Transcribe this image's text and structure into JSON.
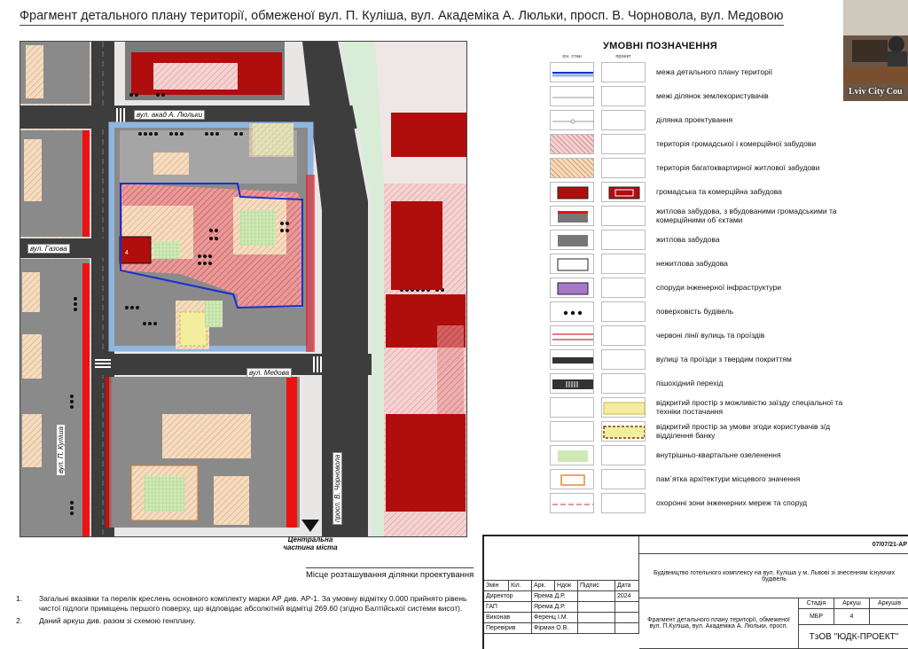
{
  "title": "Фрагмент детального плану території, обмеженої вул. П. Куліша, вул. Академіка А. Люльки, просп. В. Чорновола, вул. Медовою",
  "map": {
    "streets": {
      "lyulky": "вул. акад А. Люльки",
      "hazova": "вул. Газова",
      "medova": "вул. Медова",
      "kulisha": "вул. П. Куліша",
      "chornovola": "просп. В. Чорновола"
    },
    "location_label": "Центральна частина міста",
    "caption": "Місце розташування ділянки проектування"
  },
  "legend": {
    "title": "УМОВНІ ПОЗНАЧЕННЯ",
    "col_existing": "існ. стан",
    "col_project": "проект",
    "items": [
      {
        "label": "межа детального плану території",
        "icon": "blue-boundary-line"
      },
      {
        "label": "межі ділянок землекористувачів",
        "icon": "thin-boundary-line"
      },
      {
        "label": "ділянка проектування",
        "icon": "design-plot-line"
      },
      {
        "label": "територія громадської і комерційної забудови",
        "icon": "pink-hatch"
      },
      {
        "label": "територія багатоквартирної житлової забудови",
        "icon": "orange-hatch"
      },
      {
        "label": "громадська та комерційна забудова",
        "icon": "dark-red-block"
      },
      {
        "label": "житлова забудова, з вбудованими громадськими та комерційними об`єктами",
        "icon": "gray-red-block"
      },
      {
        "label": "житлова забудова",
        "icon": "gray-block"
      },
      {
        "label": "нежитлова забудова",
        "icon": "white-block"
      },
      {
        "label": "споруди інженерної інфраструктури",
        "icon": "purple-block"
      },
      {
        "label": "поверховість будівель",
        "icon": "dots"
      },
      {
        "label": "червоні лінії вулиць та проїздів",
        "icon": "red-lines"
      },
      {
        "label": "вулиці та проїзди з твердим покриттям",
        "icon": "road"
      },
      {
        "label": "пішохідний перехід",
        "icon": "crosswalk"
      },
      {
        "label": "відкритий простір з можливістю заїзду спеціальної та техніки постачання",
        "icon": "yellow-area"
      },
      {
        "label": "відкритий простір за умови згоди користувачів з/д відділення банку",
        "icon": "yellow-dashed-area"
      },
      {
        "label": "внутрішньо-квартальне озеленення",
        "icon": "green-area"
      },
      {
        "label": "пам`ятка архітектури місцевого значення",
        "icon": "orange-outline"
      },
      {
        "label": "охоронні зони інженерних мереж та споруд",
        "icon": "red-dash-line"
      }
    ]
  },
  "inset": {
    "label": "Lviv City Cou"
  },
  "notes": [
    {
      "num": "1.",
      "text": "Загальні вказівки та перелік креслень основного комплекту марки АР див. АР-1. За умовну відмітку 0.000 прийнято рівень чистої підлоги приміщень першого поверху, що відповідає абсолютній відмітці 269.60 (згідно Балтійської системи висот)."
    },
    {
      "num": "2.",
      "text": "Даний аркуш див. разом зі схемою генплану."
    }
  ],
  "stamp": {
    "code": "07/07/21-АР",
    "project": "Будівництво готельного комплексу на вул. Куліша у м. Львові зі знесенням існуючих будівель",
    "headers": [
      "Змін",
      "Кіл.",
      "Арк.",
      "Ндок",
      "Підпис",
      "Дата"
    ],
    "year": "2024",
    "roles": [
      {
        "role": "Директор",
        "name": "Ярема Д.Р."
      },
      {
        "role": "ГАП",
        "name": "Ярема Д.Р."
      },
      {
        "role": "Виконав",
        "name": "Ференц І.М."
      },
      {
        "role": "Перевірив",
        "name": "Фірман О.В."
      }
    ],
    "stage_label": "Стадія",
    "stage": "МБР",
    "sheet_label": "Аркуш",
    "sheet": "4",
    "sheets_label": "Аркушів",
    "sheets": "",
    "drawing": "Фрагмент детального плану території, обмеженої вул. П.Куліша, вул. Академіка А. Люльки, просп.",
    "company": "ТзОВ \"ЮДК-ПРОЕКТ\""
  }
}
